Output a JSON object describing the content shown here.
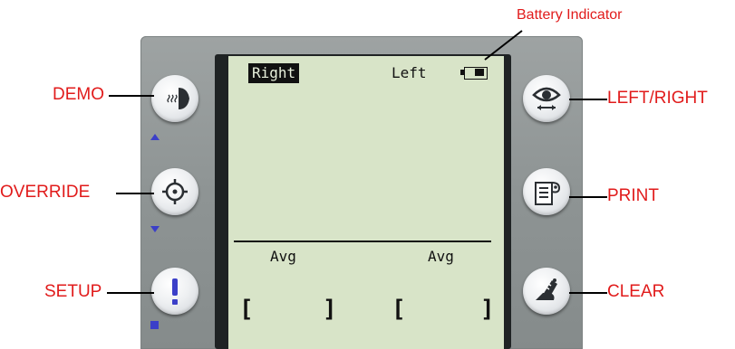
{
  "screen": {
    "tab_right": "Right",
    "tab_left": "Left",
    "avg_left": "Avg",
    "avg_right": "Avg",
    "bracket_open": "[",
    "bracket_close": "]"
  },
  "labels": {
    "battery": "Battery Indicator",
    "demo": "DEMO",
    "override": "OVERRIDE",
    "setup": "SETUP",
    "left_right": "LEFT/RIGHT",
    "print": "PRINT",
    "clear": "CLEAR"
  },
  "buttons": {
    "left": [
      {
        "name": "demo-button",
        "icon": "lens-icon"
      },
      {
        "name": "override-button",
        "icon": "crosshair-icon"
      },
      {
        "name": "setup-button",
        "icon": "exclamation-icon"
      }
    ],
    "right": [
      {
        "name": "left-right-button",
        "icon": "eye-icon"
      },
      {
        "name": "print-button",
        "icon": "printer-icon"
      },
      {
        "name": "clear-button",
        "icon": "eraser-icon"
      }
    ]
  },
  "colors": {
    "label_red": "#e11b1b",
    "device_gray": "#8e9494",
    "screen_green": "#d8e4c8",
    "indicator_blue": "#3b3fc8"
  }
}
